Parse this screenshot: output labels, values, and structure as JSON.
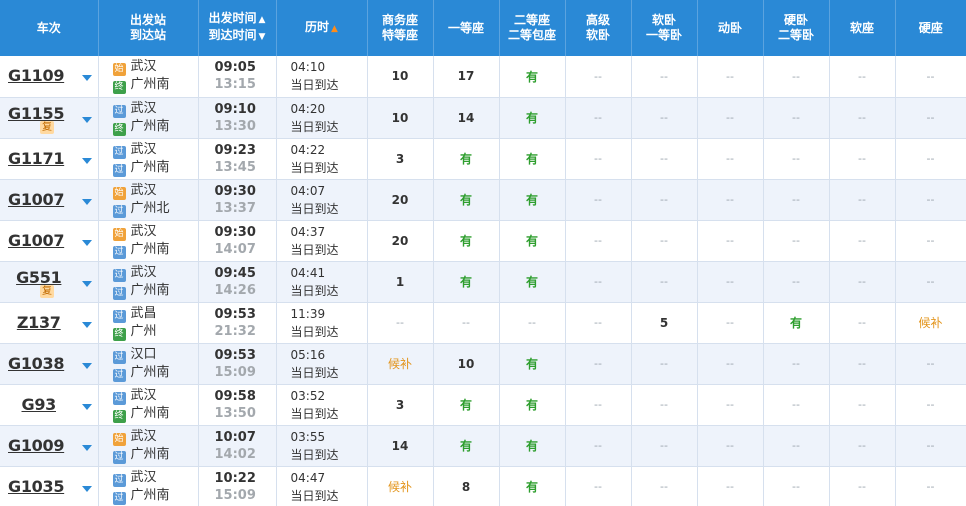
{
  "header": {
    "train": "车次",
    "station_top": "出发站",
    "station_bottom": "到达站",
    "time_top": "出发时间",
    "time_bottom": "到达时间",
    "duration": "历时",
    "biz_top": "商务座",
    "biz_bottom": "特等座",
    "first": "一等座",
    "second_top": "二等座",
    "second_bottom": "二等包座",
    "adv_top": "高级",
    "adv_bottom": "软卧",
    "soft_sleeper_top": "软卧",
    "soft_sleeper_bottom": "一等卧",
    "moving_sleeper": "动卧",
    "hard_sleeper_top": "硬卧",
    "hard_sleeper_bottom": "二等卧",
    "soft_seat": "软座",
    "hard_seat": "硬座"
  },
  "badges": {
    "start": "始",
    "pass": "过",
    "end": "终",
    "fu": "复"
  },
  "rows": [
    {
      "train_no": "G1109",
      "fu": false,
      "from_type": "start",
      "from": "武汉",
      "to_type": "end",
      "to": "广州南",
      "dep": "09:05",
      "arr": "13:15",
      "duration": "04:10",
      "note": "当日到达",
      "seats": [
        "10",
        "17",
        "有",
        "--",
        "--",
        "--",
        "--",
        "--",
        "--"
      ]
    },
    {
      "train_no": "G1155",
      "fu": true,
      "from_type": "pass",
      "from": "武汉",
      "to_type": "end",
      "to": "广州南",
      "dep": "09:10",
      "arr": "13:30",
      "duration": "04:20",
      "note": "当日到达",
      "seats": [
        "10",
        "14",
        "有",
        "--",
        "--",
        "--",
        "--",
        "--",
        "--"
      ]
    },
    {
      "train_no": "G1171",
      "fu": false,
      "from_type": "pass",
      "from": "武汉",
      "to_type": "pass",
      "to": "广州南",
      "dep": "09:23",
      "arr": "13:45",
      "duration": "04:22",
      "note": "当日到达",
      "seats": [
        "3",
        "有",
        "有",
        "--",
        "--",
        "--",
        "--",
        "--",
        "--"
      ]
    },
    {
      "train_no": "G1007",
      "fu": false,
      "from_type": "start",
      "from": "武汉",
      "to_type": "pass",
      "to": "广州北",
      "dep": "09:30",
      "arr": "13:37",
      "duration": "04:07",
      "note": "当日到达",
      "seats": [
        "20",
        "有",
        "有",
        "--",
        "--",
        "--",
        "--",
        "--",
        "--"
      ]
    },
    {
      "train_no": "G1007",
      "fu": false,
      "from_type": "start",
      "from": "武汉",
      "to_type": "pass",
      "to": "广州南",
      "dep": "09:30",
      "arr": "14:07",
      "duration": "04:37",
      "note": "当日到达",
      "seats": [
        "20",
        "有",
        "有",
        "--",
        "--",
        "--",
        "--",
        "--",
        "--"
      ]
    },
    {
      "train_no": "G551",
      "fu": true,
      "from_type": "pass",
      "from": "武汉",
      "to_type": "pass",
      "to": "广州南",
      "dep": "09:45",
      "arr": "14:26",
      "duration": "04:41",
      "note": "当日到达",
      "seats": [
        "1",
        "有",
        "有",
        "--",
        "--",
        "--",
        "--",
        "--",
        "--"
      ]
    },
    {
      "train_no": "Z137",
      "fu": false,
      "from_type": "pass",
      "from": "武昌",
      "to_type": "end",
      "to": "广州",
      "dep": "09:53",
      "arr": "21:32",
      "duration": "11:39",
      "note": "当日到达",
      "seats": [
        "--",
        "--",
        "--",
        "--",
        "5",
        "--",
        "有",
        "--",
        "候补"
      ]
    },
    {
      "train_no": "G1038",
      "fu": false,
      "from_type": "pass",
      "from": "汉口",
      "to_type": "pass",
      "to": "广州南",
      "dep": "09:53",
      "arr": "15:09",
      "duration": "05:16",
      "note": "当日到达",
      "seats": [
        "候补",
        "10",
        "有",
        "--",
        "--",
        "--",
        "--",
        "--",
        "--"
      ]
    },
    {
      "train_no": "G93",
      "fu": false,
      "from_type": "pass",
      "from": "武汉",
      "to_type": "end",
      "to": "广州南",
      "dep": "09:58",
      "arr": "13:50",
      "duration": "03:52",
      "note": "当日到达",
      "seats": [
        "3",
        "有",
        "有",
        "--",
        "--",
        "--",
        "--",
        "--",
        "--"
      ]
    },
    {
      "train_no": "G1009",
      "fu": false,
      "from_type": "start",
      "from": "武汉",
      "to_type": "pass",
      "to": "广州南",
      "dep": "10:07",
      "arr": "14:02",
      "duration": "03:55",
      "note": "当日到达",
      "seats": [
        "14",
        "有",
        "有",
        "--",
        "--",
        "--",
        "--",
        "--",
        "--"
      ]
    },
    {
      "train_no": "G1035",
      "fu": false,
      "from_type": "pass",
      "from": "武汉",
      "to_type": "pass",
      "to": "广州南",
      "dep": "10:22",
      "arr": "15:09",
      "duration": "04:47",
      "note": "当日到达",
      "seats": [
        "候补",
        "8",
        "有",
        "--",
        "--",
        "--",
        "--",
        "--",
        "--"
      ]
    }
  ],
  "colors": {
    "header_bg": "#2a89d6",
    "have": "#2e9e2e",
    "wait": "#e3941a",
    "arrive_time": "#a3a8ad"
  }
}
